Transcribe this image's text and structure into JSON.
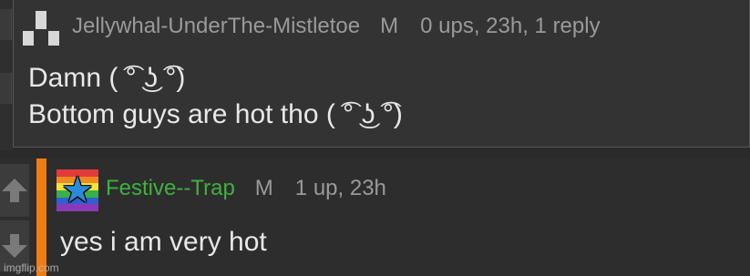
{
  "parent_comment": {
    "username": "Jellywhal-UnderThe-Mistletoe",
    "gender": "M",
    "stats": "0 ups, 23h, 1 reply",
    "lines": [
      "Damn ( ͡° ͜ʖ ͡°)",
      "Bottom guys are hot tho ( ͡° ͜ʖ ͡°)"
    ]
  },
  "reply_comment": {
    "username": "Festive--Trap",
    "gender": "M",
    "stats": "1 up, 23h",
    "text": "yes i am very hot",
    "username_color": "#3fb13f",
    "thread_bar_color": "#ef7d12"
  },
  "icons": {
    "upvote": "arrow-up-icon",
    "downvote": "arrow-down-icon",
    "avatar_parent": "pixel-blocks-avatar",
    "avatar_reply": "rainbow-star-avatar"
  },
  "watermark": "imgflip.com"
}
